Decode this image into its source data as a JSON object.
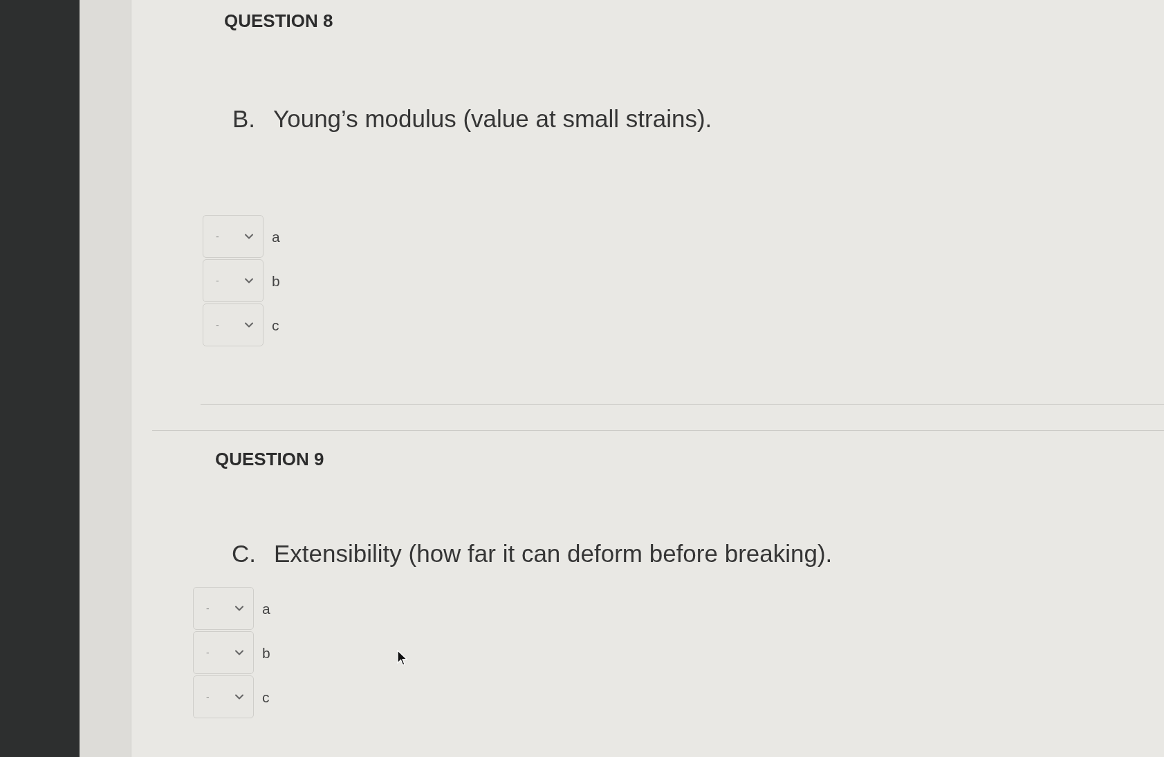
{
  "questions": [
    {
      "heading": "QUESTION 8",
      "prompt": {
        "marker": "B.",
        "text": "Young’s modulus (value at small strains)."
      },
      "answers": [
        {
          "value": "-",
          "label": "a"
        },
        {
          "value": "-",
          "label": "b"
        },
        {
          "value": "-",
          "label": "c"
        }
      ]
    },
    {
      "heading": "QUESTION 9",
      "prompt": {
        "marker": "C.",
        "text": "Extensibility (how far it can deform before breaking)."
      },
      "answers": [
        {
          "value": "-",
          "label": "a"
        },
        {
          "value": "-",
          "label": "b"
        },
        {
          "value": "-",
          "label": "c"
        }
      ]
    }
  ]
}
